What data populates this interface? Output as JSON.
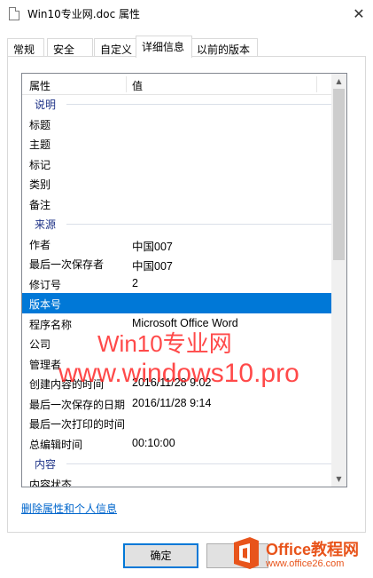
{
  "window": {
    "title": "Win10专业网.doc 属性",
    "close_glyph": "✕"
  },
  "tabs": [
    {
      "label": "常规"
    },
    {
      "label": "安全"
    },
    {
      "label": "自定义"
    },
    {
      "label": "详细信息"
    },
    {
      "label": "以前的版本"
    }
  ],
  "active_tab": "详细信息",
  "columns": {
    "property": "属性",
    "value": "值"
  },
  "rows": [
    {
      "kind": "group",
      "key": "说明"
    },
    {
      "kind": "item",
      "key": "标题",
      "value": ""
    },
    {
      "kind": "item",
      "key": "主题",
      "value": ""
    },
    {
      "kind": "item",
      "key": "标记",
      "value": ""
    },
    {
      "kind": "item",
      "key": "类别",
      "value": ""
    },
    {
      "kind": "item",
      "key": "备注",
      "value": ""
    },
    {
      "kind": "group",
      "key": "来源"
    },
    {
      "kind": "item",
      "key": "作者",
      "value": "中国007"
    },
    {
      "kind": "item",
      "key": "最后一次保存者",
      "value": "中国007"
    },
    {
      "kind": "item",
      "key": "修订号",
      "value": "2"
    },
    {
      "kind": "item",
      "key": "版本号",
      "value": "",
      "selected": true
    },
    {
      "kind": "item",
      "key": "程序名称",
      "value": "Microsoft Office Word"
    },
    {
      "kind": "item",
      "key": "公司",
      "value": ""
    },
    {
      "kind": "item",
      "key": "管理者",
      "value": ""
    },
    {
      "kind": "item",
      "key": "创建内容的时间",
      "value": "2016/11/28 9:02"
    },
    {
      "kind": "item",
      "key": "最后一次保存的日期",
      "value": "2016/11/28 9:14"
    },
    {
      "kind": "item",
      "key": "最后一次打印的时间",
      "value": ""
    },
    {
      "kind": "item",
      "key": "总编辑时间",
      "value": "00:10:00"
    },
    {
      "kind": "group",
      "key": "内容"
    },
    {
      "kind": "item",
      "key": "内容状态",
      "value": ""
    }
  ],
  "remove_link": "删除属性和个人信息",
  "buttons": {
    "ok": "确定",
    "cancel": ""
  },
  "watermark": {
    "line1": "Win10专业网",
    "line2": "www.windows10.pro"
  },
  "logo": {
    "brand": "Office教程网",
    "url": "www.office26.com"
  },
  "colors": {
    "selection": "#0078d7",
    "link": "#0066cc",
    "group": "#1e3287",
    "watermark": "#ff2a2a",
    "logo": "#e8541b"
  }
}
